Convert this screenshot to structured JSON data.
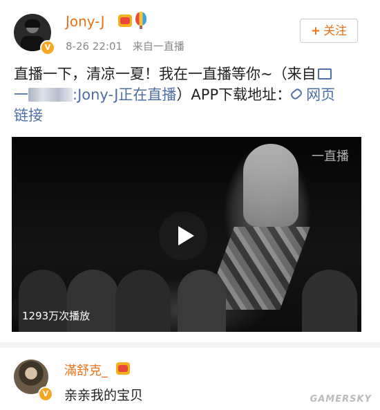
{
  "post": {
    "username": "Jony-J",
    "verified_badge": "V",
    "time": "8-26 22:01",
    "source": "来自一直播",
    "follow_label": "关注",
    "follow_plus": "+",
    "text": {
      "line1": "直播一下，清凉一夏！我在一直播等你~（来自",
      "line2_prefix": "一",
      "line2_link": ":Jony-J正在直播",
      "line2_suffix": "）APP下载地址：",
      "line2_link2": "网页",
      "line3_link": "链接"
    },
    "video": {
      "watermark": "一直播",
      "play_count": "1293万次播放"
    }
  },
  "comment": {
    "username": "滿舒克_",
    "verified_badge": "V",
    "text": "亲亲我的宝贝"
  },
  "watermark": "GAMERSKY",
  "colors": {
    "accent": "#ea7216",
    "link": "#4e6fa6",
    "meta": "#888888"
  }
}
